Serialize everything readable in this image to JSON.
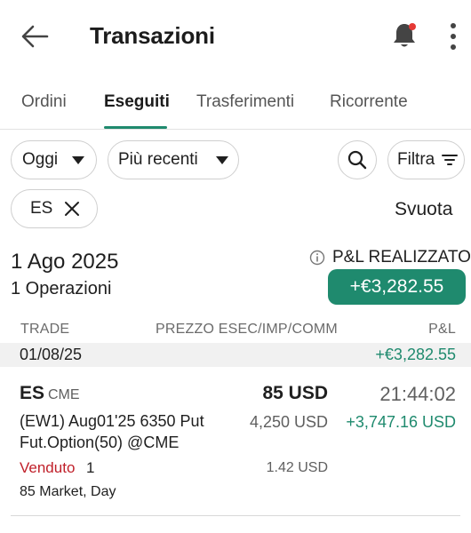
{
  "header": {
    "title": "Transazioni",
    "back_icon": "arrow-left-icon",
    "bell_icon": "bell-icon",
    "menu_icon": "kebab-menu-icon",
    "notification_dot_color": "#e53935"
  },
  "tabs": [
    {
      "label": "Ordini",
      "active": false
    },
    {
      "label": "Eseguiti",
      "active": true
    },
    {
      "label": "Trasferimenti",
      "active": false
    },
    {
      "label": "Ricorrente",
      "active": false
    }
  ],
  "filters": {
    "period": "Oggi",
    "sort": "Più recenti",
    "filter_label": "Filtra",
    "chip": "ES",
    "clear_label": "Svuota"
  },
  "summary": {
    "date": "1 Ago 2025",
    "operations": "1 Operazioni",
    "pl_label": "P&L REALIZZATO",
    "pl_value": "+€3,282.55"
  },
  "columns": {
    "trade": "TRADE",
    "price": "PREZZO ESEC/IMP/COMM",
    "pl": "P&L"
  },
  "date_row": {
    "date": "01/08/25",
    "value": "+€3,282.55"
  },
  "trade": {
    "symbol": "ES",
    "exchange": "CME",
    "qty_price": "85 USD",
    "time": "21:44:02",
    "desc_line1": "(EW1) Aug01'25 6350 Put",
    "desc_line2": "Fut.Option(50) @CME",
    "amount": "4,250 USD",
    "pl": "+3,747.16 USD",
    "side": "Venduto",
    "side_qty": "1",
    "commission": "1.42 USD",
    "order_type": "85 Market, Day"
  },
  "colors": {
    "accent": "#1f8a6e",
    "sold": "#c0202a"
  }
}
